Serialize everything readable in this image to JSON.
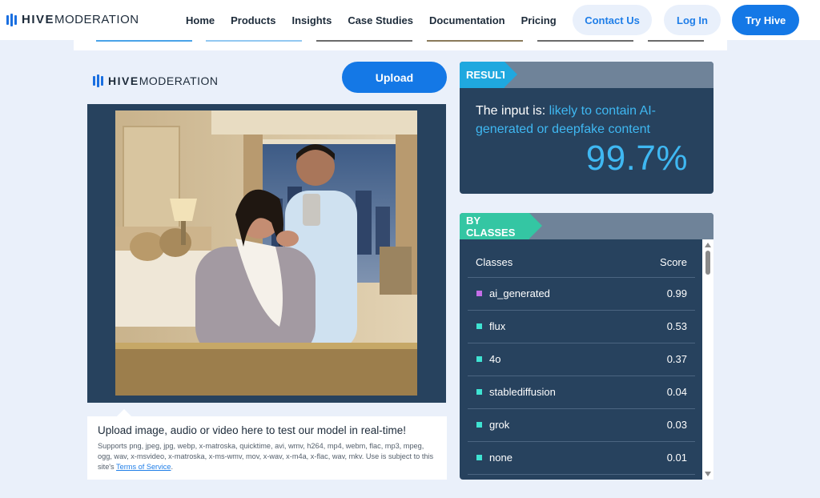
{
  "nav": {
    "brand_strong": "HIVE",
    "brand_light": "MODERATION",
    "links": [
      "Home",
      "Products",
      "Insights",
      "Case Studies",
      "Documentation",
      "Pricing"
    ],
    "contact_label": "Contact Us",
    "login_label": "Log In",
    "try_label": "Try Hive"
  },
  "demo": {
    "brand_strong": "HIVE",
    "brand_light": "MODERATION",
    "upload_label": "Upload",
    "upload_title": "Upload image, audio or video here to test our model in real-time!",
    "upload_sub": "Supports png, jpeg, jpg, webp, x-matroska, quicktime, avi, wmv, h264, mp4, webm, flac, mp3, mpeg, ogg, wav, x-msvideo, x-matroska, x-ms-wmv, mov, x-wav, x-m4a, x-flac, wav, mkv. Use is subject to this site's",
    "terms_label": "Terms of Service",
    "terms_end": "."
  },
  "result": {
    "tag": "RESULT",
    "prefix": "The input is: ",
    "verdict": "likely to contain AI-generated or deepfake content",
    "percent": "99.7%"
  },
  "classes": {
    "tag": "BY CLASSES",
    "col_classes": "Classes",
    "col_score": "Score",
    "rows": [
      {
        "name": "ai_generated",
        "score": "0.99",
        "color": "#c46ee8"
      },
      {
        "name": "flux",
        "score": "0.53",
        "color": "#3fe3d2"
      },
      {
        "name": "4o",
        "score": "0.37",
        "color": "#3fe3d2"
      },
      {
        "name": "stablediffusion",
        "score": "0.04",
        "color": "#3fe3d2"
      },
      {
        "name": "grok",
        "score": "0.03",
        "color": "#3fe3d2"
      },
      {
        "name": "none",
        "score": "0.01",
        "color": "#3fe3d2"
      }
    ]
  },
  "colors": {
    "accent": "#1478e6",
    "panel": "#27425e",
    "highlight": "#3fb8f2",
    "result_tag": "#1fa8df",
    "classes_tag": "#34c6a3"
  }
}
